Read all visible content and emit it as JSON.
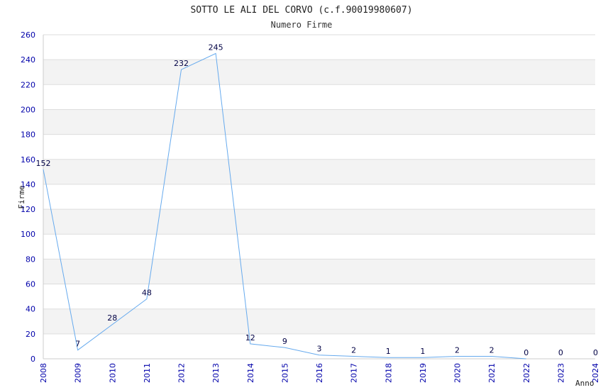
{
  "chart_data": {
    "type": "line",
    "title": "SOTTO LE ALI DEL CORVO (c.f.90019980607)",
    "subtitle": "Numero Firme",
    "xlabel": "Anno",
    "ylabel": "Firme",
    "categories": [
      "2008",
      "2009",
      "2010",
      "2011",
      "2012",
      "2013",
      "2014",
      "2015",
      "2016",
      "2017",
      "2018",
      "2019",
      "2020",
      "2021",
      "2022",
      "2023",
      "2024"
    ],
    "values": [
      152,
      7,
      28,
      48,
      232,
      245,
      12,
      9,
      3,
      2,
      1,
      1,
      2,
      2,
      0,
      0,
      0
    ],
    "point_labels": [
      "152",
      "7",
      "28",
      "48",
      "232",
      "245",
      "12",
      "9",
      "3",
      "2",
      "1",
      "1",
      "2",
      "2",
      "0",
      "0",
      "0"
    ],
    "line_values": [
      152,
      7,
      null,
      48,
      232,
      245,
      12,
      9,
      3,
      2,
      1,
      1,
      2,
      2,
      0,
      null,
      null
    ],
    "ylim": [
      0,
      260
    ],
    "yticks": [
      "0",
      "20",
      "40",
      "60",
      "80",
      "100",
      "120",
      "140",
      "160",
      "180",
      "200",
      "220",
      "240",
      "260"
    ],
    "grid": true,
    "colors": {
      "line": "#66aaee",
      "band": "#f3f3f3",
      "grid": "#dddddd",
      "tick": "#0000aa"
    }
  }
}
